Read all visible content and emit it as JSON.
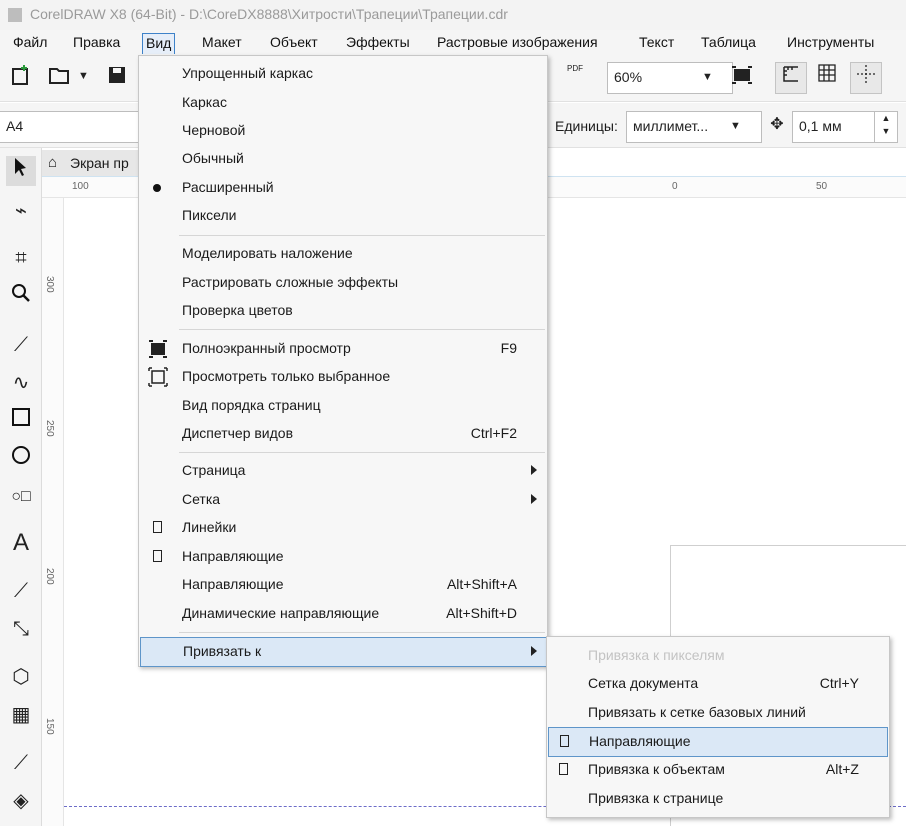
{
  "window": {
    "title": "CorelDRAW X8 (64-Bit) - D:\\CoreDX8888\\Хитрости\\Трапеции\\Трапеции.cdr"
  },
  "menubar": {
    "items": [
      "Файл",
      "Правка",
      "Вид",
      "Макет",
      "Объект",
      "Эффекты",
      "Растровые изображения",
      "Текст",
      "Таблица",
      "Инструменты"
    ],
    "active": "Вид"
  },
  "toolbar": {
    "zoom_value": "60%",
    "pdf_label": "PDF",
    "page_size_value": "A4",
    "units_label": "Единицы:",
    "units_value": "миллимет...",
    "nudge_value": "0,1 мм"
  },
  "document": {
    "tab_title": "Экран пр",
    "ruler_h_labels": [
      "100",
      "0",
      "50"
    ],
    "ruler_v_labels": [
      "300",
      "250",
      "200",
      "150"
    ]
  },
  "view_menu": {
    "items": [
      {
        "label": "Упрощенный каркас",
        "shortcut": ""
      },
      {
        "label": "Каркас",
        "shortcut": ""
      },
      {
        "label": "Черновой",
        "shortcut": ""
      },
      {
        "label": "Обычный",
        "shortcut": ""
      },
      {
        "label": "Расширенный",
        "shortcut": "",
        "marker": "bullet"
      },
      {
        "label": "Пиксели",
        "shortcut": ""
      },
      {
        "label": "Моделировать наложение",
        "shortcut": ""
      },
      {
        "label": "Растрировать сложные эффекты",
        "shortcut": ""
      },
      {
        "label": "Проверка цветов",
        "shortcut": ""
      },
      {
        "label": "Полноэкранный просмотр",
        "shortcut": "F9",
        "icon": "fullscreen-icon"
      },
      {
        "label": "Просмотреть только выбранное",
        "shortcut": "",
        "icon": "view-selected-icon"
      },
      {
        "label": "Вид порядка страниц",
        "shortcut": ""
      },
      {
        "label": "Диспетчер видов",
        "shortcut": "Ctrl+F2"
      },
      {
        "label": "Страница",
        "shortcut": "",
        "submenu": true
      },
      {
        "label": "Сетка",
        "shortcut": "",
        "submenu": true
      },
      {
        "label": "Линейки",
        "shortcut": "",
        "marker": "check"
      },
      {
        "label": "Направляющие",
        "shortcut": "",
        "marker": "check"
      },
      {
        "label": "Направляющие",
        "shortcut": "Alt+Shift+A"
      },
      {
        "label": "Динамические направляющие",
        "shortcut": "Alt+Shift+D"
      },
      {
        "label": "Привязать к",
        "shortcut": "",
        "submenu": true,
        "highlighted": true
      }
    ]
  },
  "snap_submenu": {
    "items": [
      {
        "label": "Привязка к пикселям",
        "shortcut": "",
        "disabled": true
      },
      {
        "label": "Сетка документа",
        "shortcut": "Ctrl+Y"
      },
      {
        "label": "Привязать к сетке базовых линий",
        "shortcut": ""
      },
      {
        "label": "Направляющие",
        "shortcut": "",
        "marker": "check",
        "highlighted": true
      },
      {
        "label": "Привязка к объектам",
        "shortcut": "Alt+Z",
        "marker": "check"
      },
      {
        "label": "Привязка к странице",
        "shortcut": ""
      }
    ]
  },
  "colors": {
    "highlight_bg": "#dbe8f6",
    "highlight_border": "#5e95c9",
    "guide_line": "#6c6cc8"
  }
}
